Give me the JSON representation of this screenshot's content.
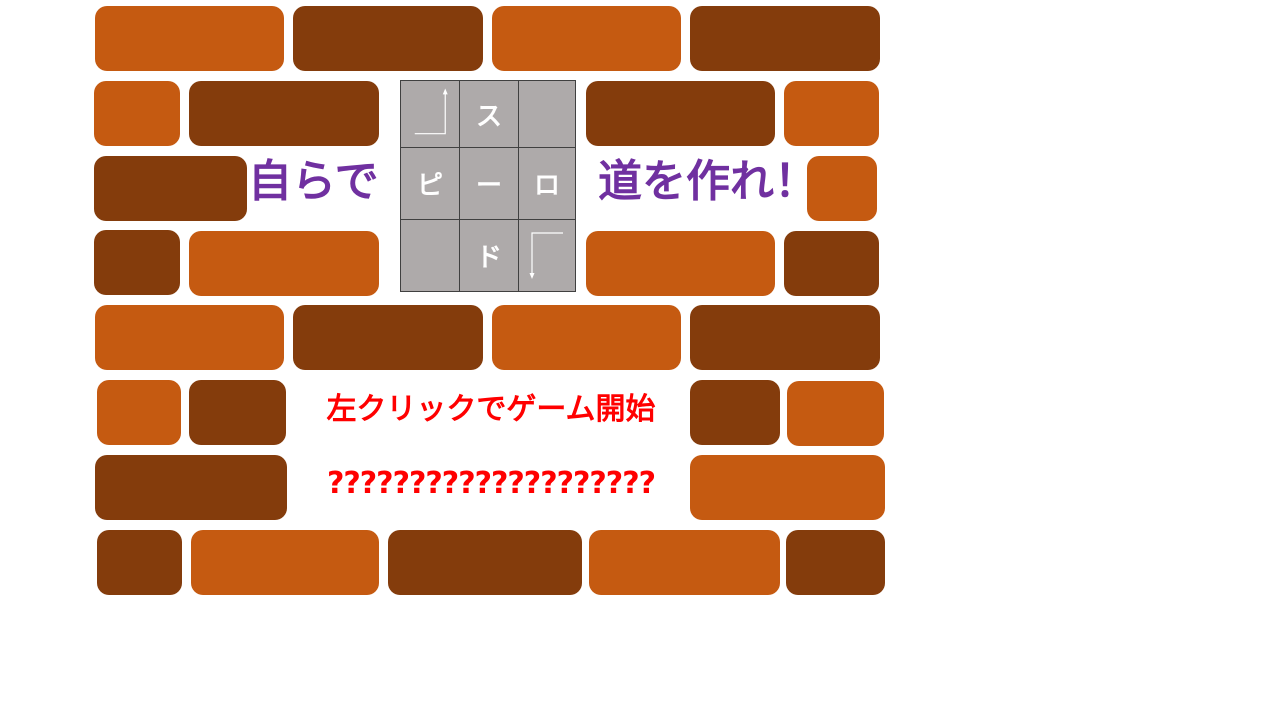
{
  "title": {
    "left": "自らで",
    "right": "道を作れ！"
  },
  "puzzle": {
    "cells": [
      "",
      "ス",
      "",
      "ピ",
      "ー",
      "ロ",
      "",
      "ド",
      ""
    ],
    "arrow_cells": {
      "top_left": "arrow-up-icon",
      "bottom_right": "arrow-down-icon"
    }
  },
  "start_prompt": "左クリックでゲーム開始",
  "garbled_text": "????????????????????",
  "colors": {
    "brick_light": "#c55a11",
    "brick_dark": "#843c0c",
    "title": "#7030a0",
    "prompt": "#ff0000",
    "puzzle_bg": "#aeaaaa"
  }
}
